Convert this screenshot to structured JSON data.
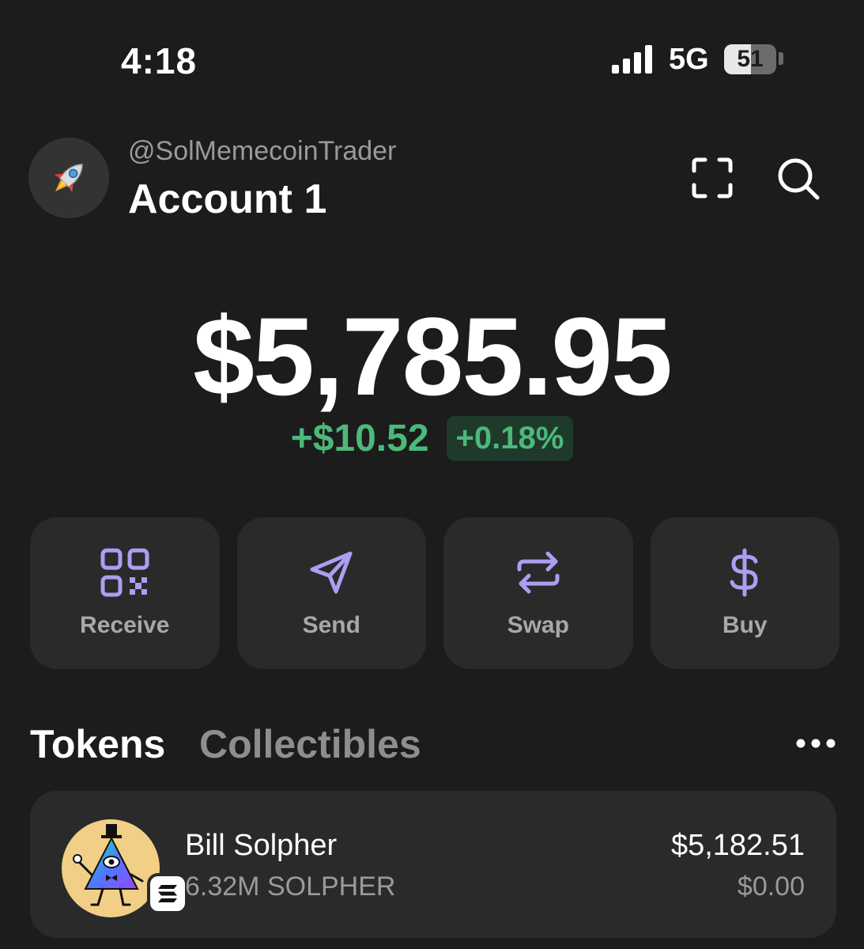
{
  "status_bar": {
    "time": "4:18",
    "network": "5G",
    "battery_percent": "51",
    "battery_level": 0.51
  },
  "header": {
    "avatar_icon": "rocket-icon",
    "username": "@SolMemecoinTrader",
    "account_name": "Account 1",
    "scan_icon": "scan-icon",
    "search_icon": "search-icon"
  },
  "balance": {
    "total": "$5,785.95",
    "change_amount": "+$10.52",
    "change_percent": "+0.18%",
    "positive_color": "#4cb97a"
  },
  "actions": [
    {
      "label": "Receive",
      "icon": "qr-code-icon"
    },
    {
      "label": "Send",
      "icon": "send-icon"
    },
    {
      "label": "Swap",
      "icon": "swap-icon"
    },
    {
      "label": "Buy",
      "icon": "dollar-icon"
    }
  ],
  "accent_color": "#ab9ff2",
  "tabs": {
    "active": "Tokens",
    "tokens_label": "Tokens",
    "collectibles_label": "Collectibles",
    "more_icon": "more-icon"
  },
  "tokens": [
    {
      "name": "Bill Solpher",
      "amount": "6.32M SOLPHER",
      "value": "$5,182.51",
      "change": "$0.00",
      "logo_icon": "bill-solpher-logo",
      "chain_icon": "solana-icon"
    }
  ]
}
